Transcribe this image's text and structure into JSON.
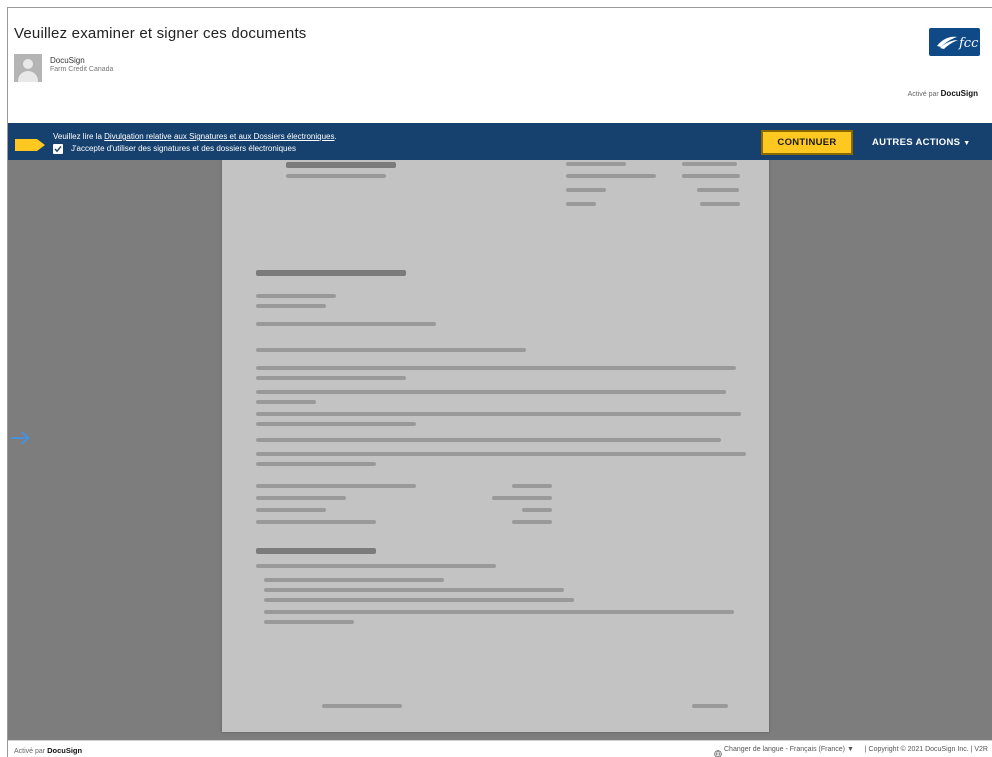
{
  "header": {
    "title": "Veuillez examiner et signer ces documents",
    "sender_name": "DocuSign",
    "sender_org": "Farm Credit Canada",
    "logo_text": "fcc",
    "powered_by_prefix": "Activé par",
    "powered_by_brand": "DocuSign"
  },
  "action_bar": {
    "disclosure_prefix": "Veuillez lire la",
    "disclosure_link": "Divulgation relative aux Signatures et aux Dossiers électroniques",
    "disclosure_suffix": ".",
    "consent_label": "J'accepte d'utiliser des signatures et des dossiers électroniques",
    "consent_checked": true,
    "continue_label": "CONTINUER",
    "other_actions_label": "AUTRES ACTIONS"
  },
  "footer": {
    "powered_by_prefix": "Activé par",
    "powered_by_brand": "DocuSign",
    "language_select": "Changer de langue - Français (France)",
    "copyright": "| Copyright © 2021 DocuSign Inc. | V2R"
  },
  "colors": {
    "action_bar": "#16416e",
    "continue_button": "#ffc820",
    "tag": "#ffc820",
    "logo_bg": "#0f4a87",
    "arrow": "#4a90d9"
  },
  "icons": {
    "tag": "tag-icon",
    "checkbox": "checkbox-icon",
    "arrow": "arrow-right-icon",
    "globe": "globe-icon",
    "caret": "caret-down-icon"
  }
}
